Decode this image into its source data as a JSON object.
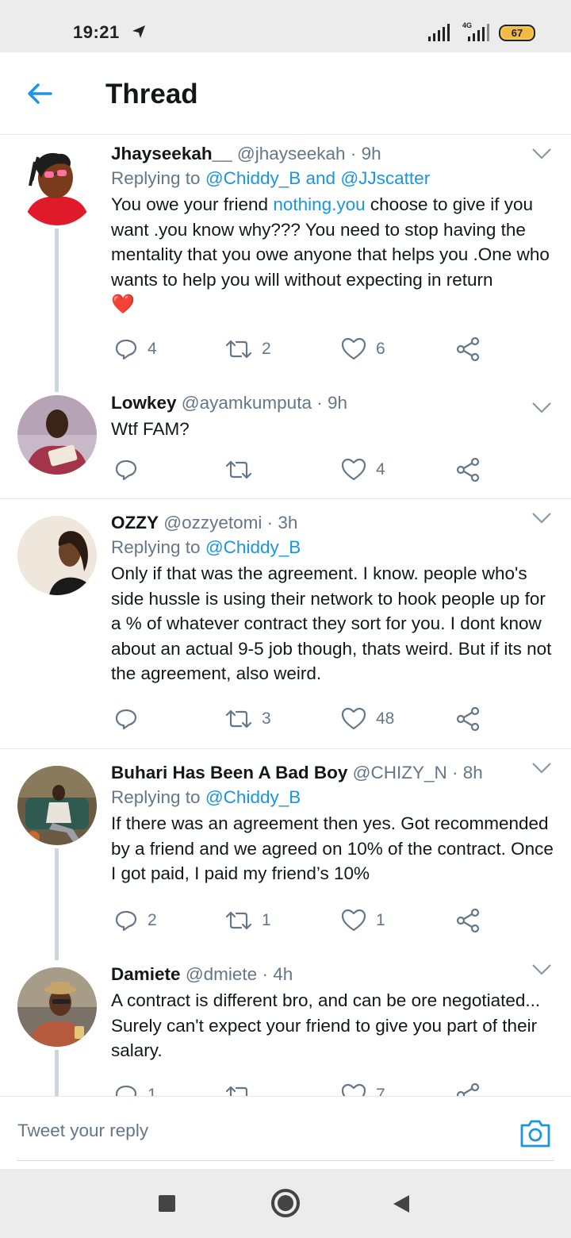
{
  "status_bar": {
    "time": "19:21",
    "network": "4G",
    "battery": "67"
  },
  "header": {
    "title": "Thread"
  },
  "tweets": [
    {
      "name": "Jhayseekah__",
      "handle": "@jhayseekah",
      "time": "· 9h",
      "replying_prefix": "Replying to",
      "replying_to_1": "@Chiddy_B",
      "replying_and": "and",
      "replying_to_2": "@JJscatter",
      "text_1": "You owe your friend ",
      "text_link": "nothing.you",
      "text_2": " choose to give if you want .you know why??? You need to stop having the mentality that you owe anyone that helps you .One who wants to help you will without expecting in return",
      "emoji": "❤️",
      "replies": "4",
      "retweets": "2",
      "likes": "6"
    },
    {
      "name": "Lowkey",
      "handle": "@ayamkumputa",
      "time": "· 9h",
      "text": "Wtf FAM?",
      "replies": "",
      "retweets": "",
      "likes": "4"
    },
    {
      "name": "OZZY",
      "handle": "@ozzyetomi",
      "time": "· 3h",
      "replying_prefix": "Replying to",
      "replying_to_1": "@Chiddy_B",
      "text": "Only if that was the agreement. I know. people who's side hussle is using their network to hook people up for a % of whatever contract they sort for you. I dont know about an actual 9-5 job though, thats weird. But if its not the agreement, also weird.",
      "replies": "",
      "retweets": "3",
      "likes": "48"
    },
    {
      "name": "Buhari Has Been A Bad Boy",
      "handle": "@CHIZY_N",
      "time": "· 8h",
      "replying_prefix": "Replying to",
      "replying_to_1": "@Chiddy_B",
      "text": "If there was an agreement then yes. Got recommended by a friend and we agreed on 10% of the contract. Once I got paid, I paid my friend’s 10%",
      "replies": "2",
      "retweets": "1",
      "likes": "1"
    },
    {
      "name": "Damiete",
      "handle": "@dmiete",
      "time": "· 4h",
      "text": "A contract is different bro, and can be ore negotiated... Surely can't expect your friend to give you part of their salary.",
      "replies": "1",
      "retweets": "",
      "likes": "7"
    }
  ],
  "reply_bar": {
    "placeholder": "Tweet your reply"
  },
  "colors": {
    "accent": "#1b95e0",
    "secondary_text": "#657786",
    "divider": "#e1e8ed",
    "thread_line": "#ccd6dd"
  },
  "icons": [
    "back-arrow-icon",
    "reply-icon",
    "retweet-icon",
    "like-icon",
    "share-icon",
    "chevron-down-icon",
    "camera-icon"
  ]
}
